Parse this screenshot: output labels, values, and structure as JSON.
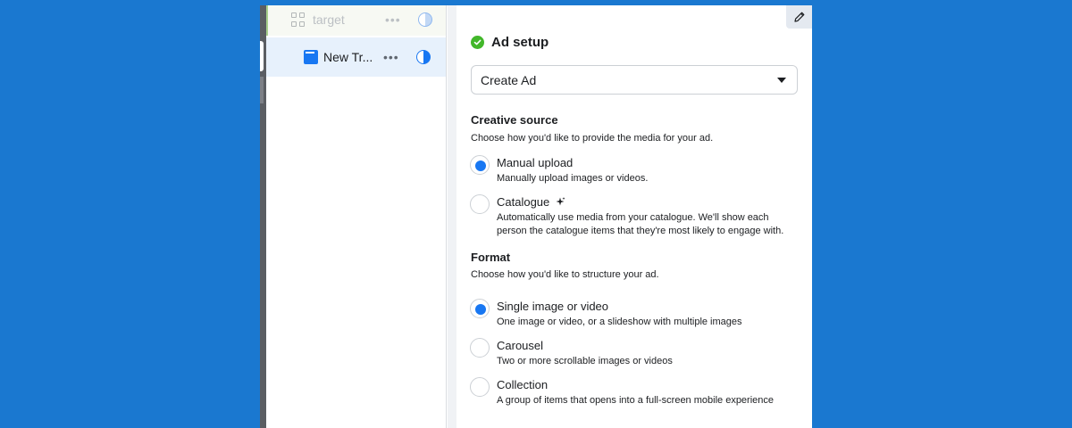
{
  "tree": {
    "adset": {
      "label": "target",
      "icon": "grid-icon",
      "menu": "•••",
      "status_icon": "half-circle-icon"
    },
    "ad": {
      "label": "New Tr...",
      "icon": "ad-icon",
      "menu": "•••",
      "status_icon": "half-circle-icon"
    }
  },
  "editor": {
    "edit_icon": "pencil-icon",
    "section_title": "Ad setup",
    "section_status_icon": "check-circle-icon",
    "dropdown": {
      "value": "Create Ad",
      "icon": "caret-down-icon"
    },
    "creative_source": {
      "heading": "Creative source",
      "description": "Choose how you'd like to provide the media for your ad.",
      "options": [
        {
          "label": "Manual upload",
          "description": "Manually upload images or videos.",
          "selected": true
        },
        {
          "label": "Catalogue",
          "description": "Automatically use media from your catalogue. We'll show each person the catalogue items that they're most likely to engage with.",
          "selected": false,
          "icon": "sparkle-icon"
        }
      ]
    },
    "format": {
      "heading": "Format",
      "description": "Choose how you'd like to structure your ad.",
      "options": [
        {
          "label": "Single image or video",
          "description": "One image or video, or a slideshow with multiple images",
          "selected": true
        },
        {
          "label": "Carousel",
          "description": "Two or more scrollable images or videos",
          "selected": false
        },
        {
          "label": "Collection",
          "description": "A group of items that opens into a full-screen mobile experience",
          "selected": false
        }
      ]
    }
  },
  "colors": {
    "background": "#1a78d0",
    "accent": "#1877f2",
    "success": "#42b72a"
  }
}
